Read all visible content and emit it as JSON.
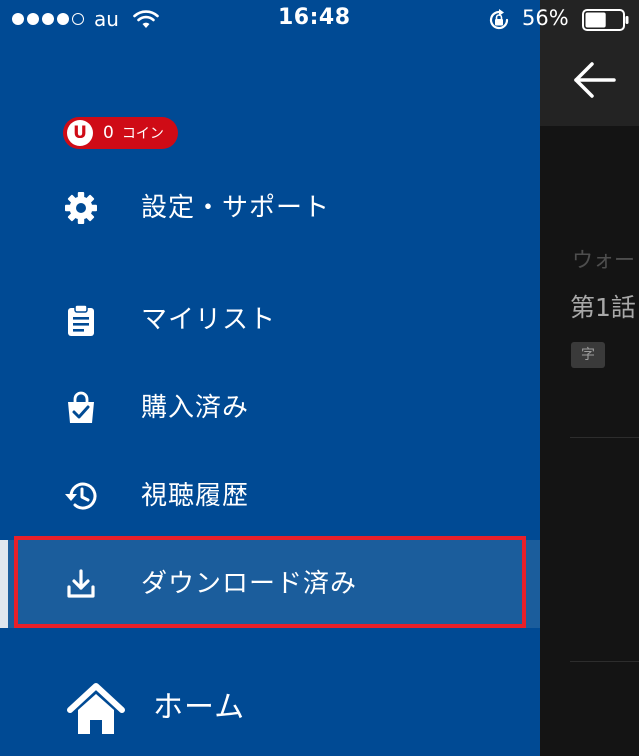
{
  "status_bar": {
    "carrier": "au",
    "time": "16:48",
    "battery_percent": "56%",
    "battery_level": 0.56,
    "signal_strength": 4
  },
  "coin": {
    "logo_letter": "U",
    "count": "0",
    "unit": "コイン"
  },
  "menu": {
    "settings_support": "設定・サポート",
    "mylist": "マイリスト",
    "purchased": "購入済み",
    "history": "視聴履歴",
    "downloaded": "ダウンロード済み",
    "home": "ホーム"
  },
  "icons": {
    "settings": "gear-icon",
    "mylist": "clipboard-icon",
    "purchased": "shopping-bag-check-icon",
    "history": "history-clock-icon",
    "downloaded": "download-icon",
    "home": "home-icon",
    "back": "arrow-left-icon"
  },
  "content": {
    "subtitle": "ウォー",
    "episode": "第1話",
    "subtitle_badge": "字"
  },
  "colors": {
    "drawer_background": "#004a94",
    "active_item": "#1b5d9c",
    "coin_badge": "#cf0b16",
    "highlight": "#e8202a"
  }
}
